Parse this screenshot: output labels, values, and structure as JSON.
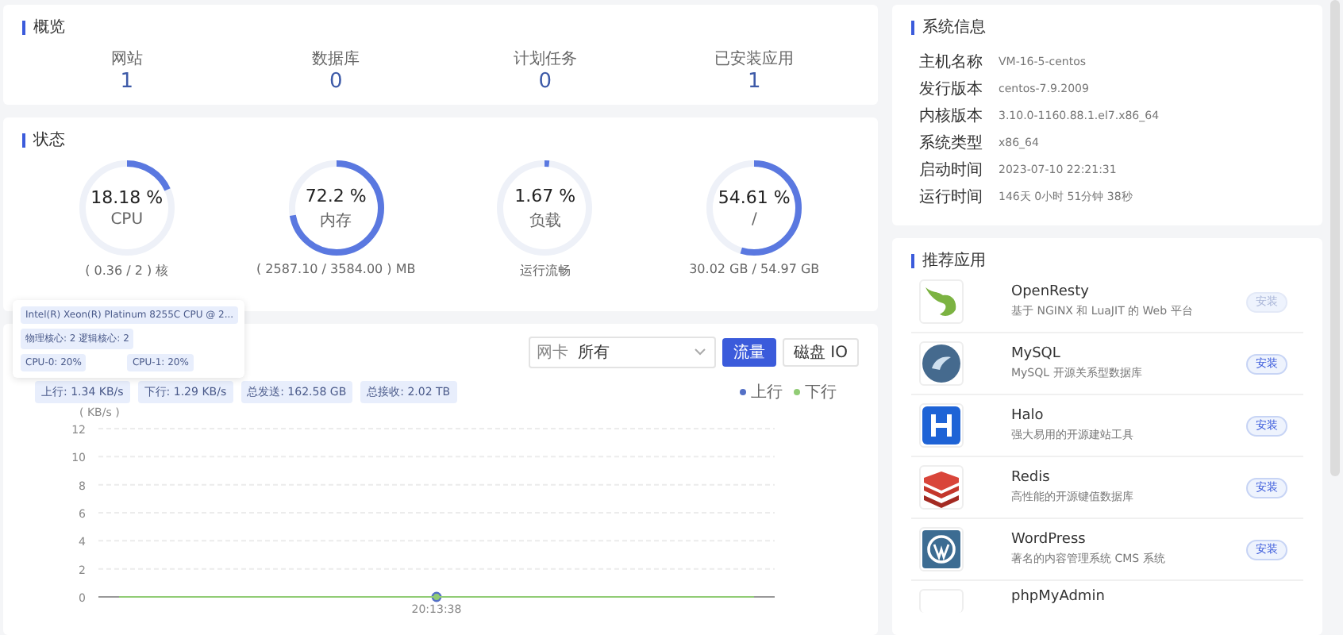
{
  "overview": {
    "title": "概览",
    "items": [
      {
        "label": "网站",
        "value": "1"
      },
      {
        "label": "数据库",
        "value": "0"
      },
      {
        "label": "计划任务",
        "value": "0"
      },
      {
        "label": "已安装应用",
        "value": "1"
      }
    ]
  },
  "status": {
    "title": "状态",
    "gauges": [
      {
        "value": "18.18 %",
        "name": "CPU",
        "level": 0.1818,
        "detail": "( 0.36 / 2 ) 核"
      },
      {
        "value": "72.2 %",
        "name": "内存",
        "level": 0.722,
        "detail": "( 2587.10 / 3584.00 ) MB"
      },
      {
        "value": "1.67 %",
        "name": "负载",
        "level": 0.0167,
        "detail": "运行流畅"
      },
      {
        "value": "54.61 %",
        "name": "/",
        "level": 0.5461,
        "detail": "30.02 GB / 54.97 GB"
      }
    ]
  },
  "cpu_tooltip": {
    "model": "Intel(R) Xeon(R) Platinum 8255C CPU @ 2...",
    "cores": "物理核心: 2 逻辑核心: 2",
    "per_core": [
      "CPU-0: 20%",
      "CPU-1: 20%"
    ]
  },
  "monitor": {
    "select_label": "网卡",
    "select_value": "所有",
    "tabs": [
      {
        "label": "流量",
        "selected": true
      },
      {
        "label": "磁盘 IO",
        "selected": false
      }
    ],
    "tags": [
      "上行: 1.34 KB/s",
      "下行: 1.29 KB/s",
      "总发送: 162.58 GB",
      "总接收: 2.02 TB"
    ],
    "chart_data": {
      "type": "line",
      "grid": true,
      "ylabel": "( KB/s )",
      "x": [
        "20:13:38"
      ],
      "yticks": [
        0,
        2,
        4,
        6,
        8,
        10,
        12
      ],
      "ylim": [
        0,
        12
      ],
      "series": [
        {
          "name": "上行",
          "color": "#5470c6",
          "marker": true,
          "values": [
            0
          ]
        },
        {
          "name": "下行",
          "color": "#91cc75",
          "marker": true,
          "values": [
            0
          ]
        }
      ]
    }
  },
  "system_info": {
    "title": "系统信息",
    "rows": [
      {
        "label": "主机名称",
        "value": "VM-16-5-centos"
      },
      {
        "label": "发行版本",
        "value": "centos-7.9.2009"
      },
      {
        "label": "内核版本",
        "value": "3.10.0-1160.88.1.el7.x86_64"
      },
      {
        "label": "系统类型",
        "value": "x86_64"
      },
      {
        "label": "启动时间",
        "value": "2023-07-10 22:21:31"
      },
      {
        "label": "运行时间",
        "value": "146天 0小时 51分钟 38秒"
      }
    ]
  },
  "apps": {
    "title": "推荐应用",
    "items": [
      {
        "kind": "openresty",
        "name": "OpenResty",
        "description": "基于 NGINX 和 LuaJIT 的 Web 平台",
        "button": "安装",
        "disabled": true
      },
      {
        "kind": "mysql",
        "name": "MySQL",
        "description": "MySQL 开源关系型数据库",
        "button": "安装",
        "disabled": false
      },
      {
        "kind": "halo",
        "name": "Halo",
        "description": "强大易用的开源建站工具",
        "button": "安装",
        "disabled": false
      },
      {
        "kind": "redis",
        "name": "Redis",
        "description": "高性能的开源键值数据库",
        "button": "安装",
        "disabled": false
      },
      {
        "kind": "wordpress",
        "name": "WordPress",
        "description": "著名的内容管理系统 CMS 系统",
        "button": "安装",
        "disabled": false
      },
      {
        "kind": "phpmyadmin",
        "name": "phpMyAdmin"
      }
    ]
  }
}
